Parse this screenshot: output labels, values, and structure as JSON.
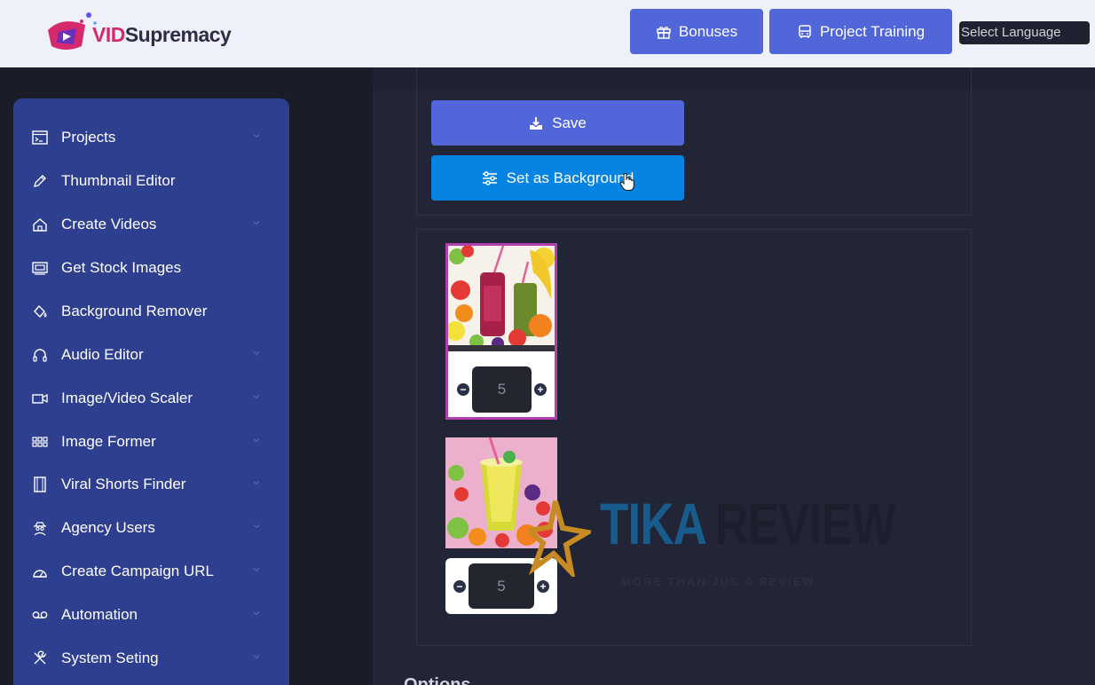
{
  "header": {
    "logo_text_vid": "VID",
    "logo_text_rest": "Supremacy",
    "bonuses_label": "Bonuses",
    "training_label": "Project Training",
    "language_placeholder": "Select Language"
  },
  "sidebar": {
    "items": [
      {
        "label": "Projects",
        "icon": "terminal-window-icon",
        "has_chevron": true
      },
      {
        "label": "Thumbnail Editor",
        "icon": "pen-icon",
        "has_chevron": false
      },
      {
        "label": "Create Videos",
        "icon": "house-icon",
        "has_chevron": true
      },
      {
        "label": "Get Stock Images",
        "icon": "images-stack-icon",
        "has_chevron": false
      },
      {
        "label": "Background Remover",
        "icon": "paint-bucket-icon",
        "has_chevron": false
      },
      {
        "label": "Audio Editor",
        "icon": "headphones-icon",
        "has_chevron": true
      },
      {
        "label": "Image/Video Scaler",
        "icon": "video-camera-icon",
        "has_chevron": true
      },
      {
        "label": "Image Former",
        "icon": "grid-icon",
        "has_chevron": true
      },
      {
        "label": "Viral Shorts Finder",
        "icon": "film-strip-icon",
        "has_chevron": true
      },
      {
        "label": "Agency Users",
        "icon": "user-spy-icon",
        "has_chevron": true
      },
      {
        "label": "Create Campaign URL",
        "icon": "dashboard-icon",
        "has_chevron": true
      },
      {
        "label": "Automation",
        "icon": "cassette-icon",
        "has_chevron": true
      },
      {
        "label": "System Seting",
        "icon": "tools-icon",
        "has_chevron": true
      }
    ]
  },
  "main": {
    "save_label": "Save",
    "set_background_label": "Set as Background",
    "images": [
      {
        "name": "fruit-smoothie-bottles",
        "value": "5",
        "selected": true
      },
      {
        "name": "fruit-smoothie-glass",
        "value": "5",
        "selected": false
      }
    ],
    "options_heading": "Options"
  },
  "watermark": {
    "title_part1": "TIKA",
    "title_part2": "REVIEW",
    "subtitle": "MORE THAN JUS A REVIEW"
  },
  "colors": {
    "primary_button": "#5166d9",
    "set_background_button": "#0584e3",
    "sidebar": "#2e3f8f",
    "selected_border": "#b13fae"
  }
}
